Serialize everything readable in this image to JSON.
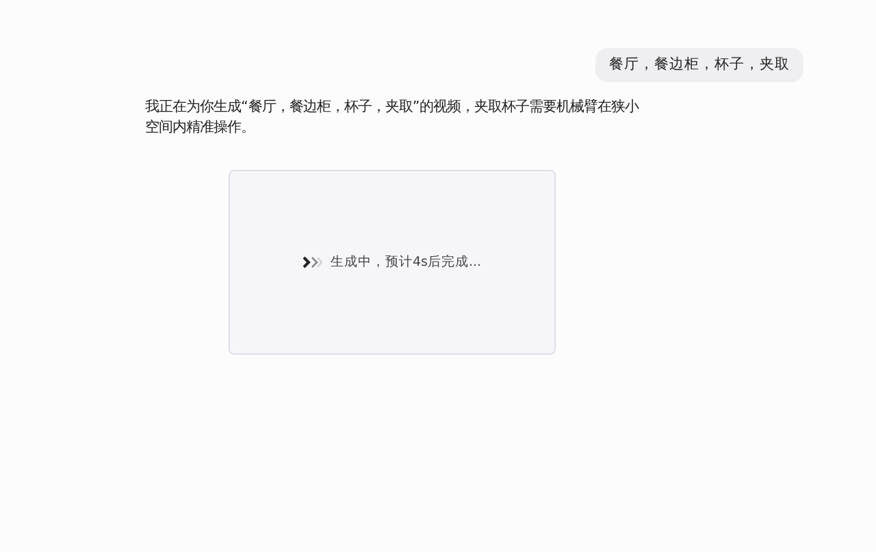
{
  "user_message": "餐厅，餐边柜，杯子，夹取",
  "assistant_message": "我正在为你生成“餐厅，餐边柜，杯子，夹取”的视频，夹取杯子需要机械臂在狭小空间内精准操作。",
  "video_card": {
    "status": "生成中，预计4s后完成..."
  }
}
